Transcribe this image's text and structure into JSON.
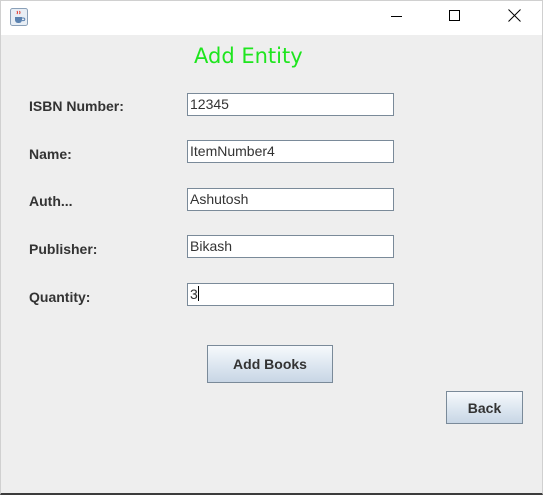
{
  "window": {
    "controls": {
      "minimize_icon": "minimize-icon",
      "maximize_icon": "maximize-icon",
      "close_icon": "close-icon"
    },
    "app_icon": "java-coffee-cup-icon"
  },
  "form": {
    "heading": "Add Entity",
    "heading_color": "#1ee51e",
    "fields": [
      {
        "label": "ISBN Number:",
        "value": "12345"
      },
      {
        "label": "Name:",
        "value": "ItemNumber4"
      },
      {
        "label": "Auth...",
        "value": "Ashutosh"
      },
      {
        "label": "Publisher:",
        "value": "Bikash"
      },
      {
        "label": "Quantity:",
        "value": "3"
      }
    ],
    "add_button_label": "Add Books",
    "back_button_label": "Back"
  }
}
